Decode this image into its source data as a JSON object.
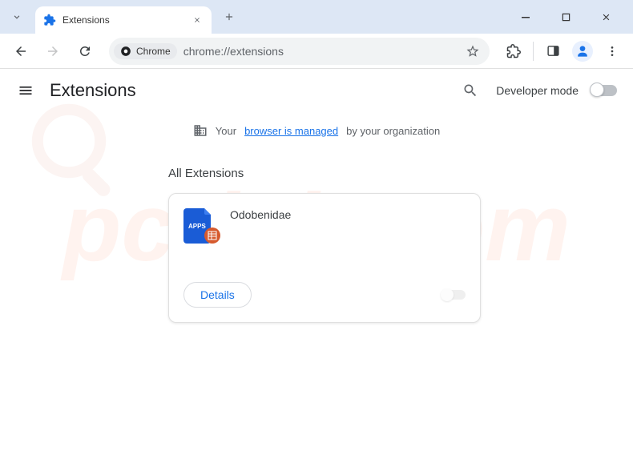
{
  "tab": {
    "title": "Extensions"
  },
  "addressbar": {
    "chip": "Chrome",
    "url": "chrome://extensions"
  },
  "header": {
    "title": "Extensions",
    "devmode_label": "Developer mode"
  },
  "managed": {
    "prefix": "Your",
    "link": "browser is managed",
    "suffix": "by your organization"
  },
  "section": {
    "all_label": "All Extensions"
  },
  "extension": {
    "name": "Odobenidae",
    "icon_label": "APPS",
    "details_label": "Details"
  }
}
